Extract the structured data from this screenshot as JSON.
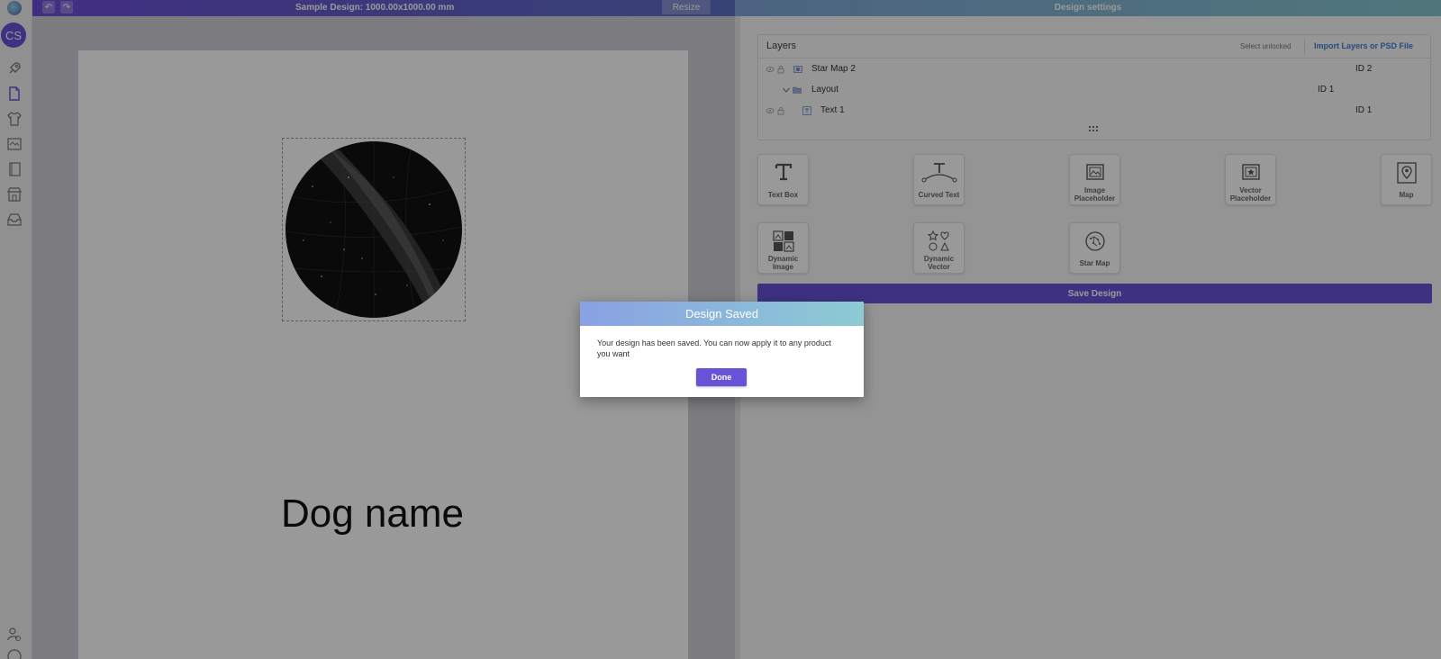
{
  "topbar": {
    "title": "Sample Design: 1000.00x1000.00 mm",
    "resize_label": "Resize",
    "settings_title": "Design settings",
    "undo_icon": "undo-icon",
    "redo_icon": "redo-icon"
  },
  "sidebar": {
    "avatar_initials": "CS",
    "items": [
      {
        "icon": "rocket-icon"
      },
      {
        "icon": "document-icon"
      },
      {
        "icon": "tshirt-icon"
      },
      {
        "icon": "gallery-icon"
      },
      {
        "icon": "book-icon"
      },
      {
        "icon": "store-icon"
      },
      {
        "icon": "inbox-icon"
      }
    ],
    "bottom_items": [
      {
        "icon": "user-settings-icon"
      },
      {
        "icon": "help-icon"
      }
    ]
  },
  "canvas": {
    "text_layer": "Dog name"
  },
  "layers": {
    "title": "Layers",
    "select_unlocked": "Select unlocked",
    "import_label": "Import Layers or PSD File",
    "rows": [
      {
        "name": "Star Map 2",
        "id": "ID 2"
      },
      {
        "name": "Layout",
        "id": "ID 1"
      },
      {
        "name": "Text 1",
        "id": "ID 1"
      }
    ]
  },
  "tools": {
    "text_box": "Text Box",
    "curved_text": "Curved Text",
    "image_placeholder": "Image Placeholder",
    "vector_placeholder": "Vector Placeholder",
    "map": "Map",
    "dynamic_image": "Dynamic Image",
    "dynamic_vector": "Dynamic Vector",
    "star_map": "Star Map"
  },
  "save_design_label": "Save Design",
  "modal": {
    "title": "Design Saved",
    "message": "Your design has been saved. You can now apply it to any product you want",
    "done_label": "Done"
  },
  "colors": {
    "accent": "#6a52d8",
    "link": "#3b7fd6",
    "topbar_left": "#6c4fd8",
    "topbar_right": "#86c6cf"
  }
}
